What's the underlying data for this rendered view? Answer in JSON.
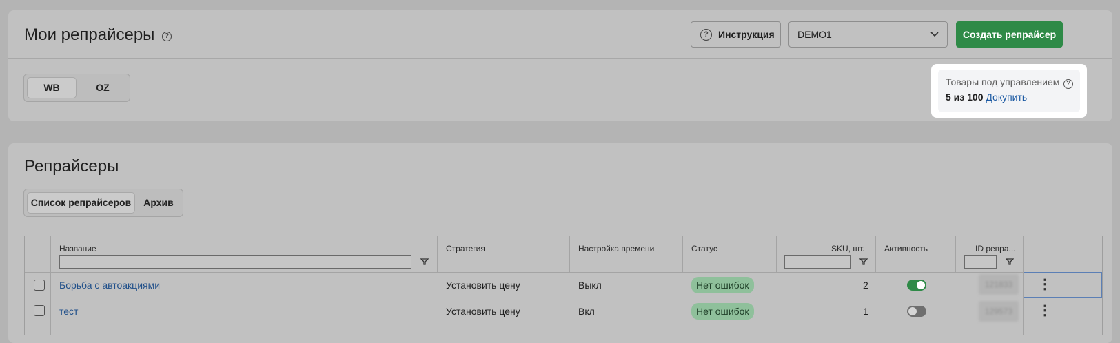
{
  "header": {
    "title": "Мои репрайсеры",
    "instruction_label": "Инструкция",
    "account_select_value": "DEMO1",
    "create_button_label": "Создать репрайсер"
  },
  "marketplace_tabs": [
    {
      "label": "WB",
      "active": true
    },
    {
      "label": "OZ",
      "active": false
    }
  ],
  "quota": {
    "label": "Товары под управлением",
    "count_text": "5 из 100",
    "buy_more_label": "Докупить"
  },
  "repricers_section": {
    "title": "Репрайсеры",
    "tabs": [
      {
        "label": "Список репрайсеров",
        "active": true
      },
      {
        "label": "Архив",
        "active": false
      }
    ]
  },
  "table": {
    "columns": {
      "name": "Название",
      "strategy": "Стратегия",
      "time_setting": "Настройка времени",
      "status": "Статус",
      "sku": "SKU, шт.",
      "activity": "Активность",
      "id": "ID репра..."
    },
    "rows": [
      {
        "name": "Борьба с автоакциями",
        "strategy": "Установить цену",
        "time_setting": "Выкл",
        "status": "Нет ошибок",
        "sku": "2",
        "active": true,
        "id": "121833"
      },
      {
        "name": "тест",
        "strategy": "Установить цену",
        "time_setting": "Вкл",
        "status": "Нет ошибок",
        "sku": "1",
        "active": false,
        "id": "129573"
      }
    ]
  },
  "colors": {
    "accent_green": "#2e8a47",
    "link_blue": "#21508a",
    "status_badge_bg": "#8fc09b",
    "overlay_gray": "#b4b4b4"
  }
}
